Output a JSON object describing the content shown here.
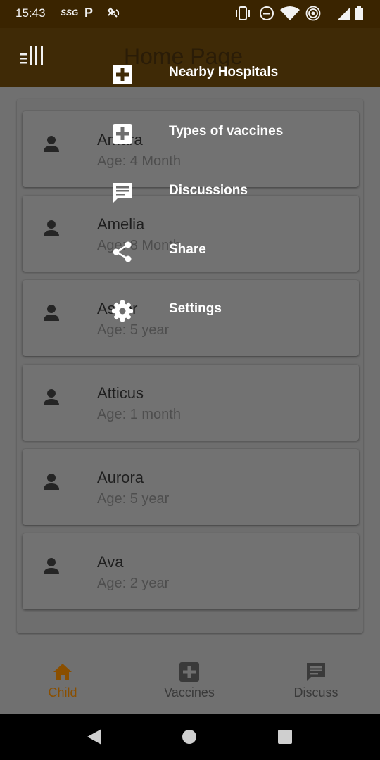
{
  "status_bar": {
    "time": "15:43",
    "carrier_badge": "SSG",
    "parking_icon": "P",
    "icons": [
      "vibrate-icon",
      "do-not-disturb-icon",
      "wifi-icon",
      "hotspot-icon",
      "signal-icon",
      "battery-icon"
    ]
  },
  "app_bar": {
    "title": "Home Page",
    "menu_icon": "menu-icon"
  },
  "overlay_menu": {
    "items": [
      {
        "label": "Nearby Hospitals",
        "icon": "hospital-icon"
      },
      {
        "label": "Types of vaccines",
        "icon": "hospital-icon"
      },
      {
        "label": "Discussions",
        "icon": "chat-icon"
      },
      {
        "label": "Share",
        "icon": "share-icon"
      },
      {
        "label": "Settings",
        "icon": "gear-icon"
      }
    ]
  },
  "children": [
    {
      "name": "Amara",
      "age": "Age: 4 Month"
    },
    {
      "name": "Amelia",
      "age": "Age: 8 Month"
    },
    {
      "name": "Asher",
      "age": "Age: 5 year"
    },
    {
      "name": "Atticus",
      "age": "Age: 1 month"
    },
    {
      "name": "Aurora",
      "age": "Age: 5 year"
    },
    {
      "name": "Ava",
      "age": "Age: 2 year"
    }
  ],
  "bottom_nav": {
    "items": [
      {
        "label": "Child",
        "icon": "home-icon",
        "active": true
      },
      {
        "label": "Vaccines",
        "icon": "hospital-icon",
        "active": false
      },
      {
        "label": "Discuss",
        "icon": "chat-icon",
        "active": false
      }
    ]
  },
  "colors": {
    "status_bar_bg": "#3a2400",
    "app_bar_bg": "#3f2a06",
    "active_nav": "#8a4f00",
    "inactive_nav": "#3a3a3a",
    "scrim": "#707070"
  }
}
